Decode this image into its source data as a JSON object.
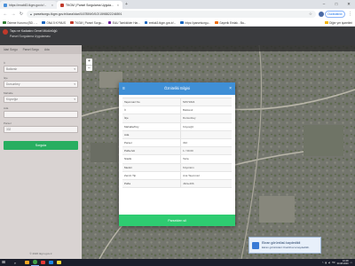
{
  "browser": {
    "tabs": [
      {
        "title": "https://enabil3.tkgm.gov.tr/...",
        "color": "#4a90d9"
      },
      {
        "title": "TKGM | Parsel Sorgulama Uygula...",
        "color": "#c0392b"
      }
    ],
    "new_tab": "+",
    "window": {
      "minimize": "–",
      "maximize": "□",
      "close": "✕"
    },
    "url": "parselsorgu.tkgm.gov.tr/#ara/idari/167859/0/0/2/1598822246591",
    "profile_label": "Duraklatıldı",
    "bookmarks": [
      {
        "label": "Ödeme Kurumu (BD - ...",
        "color": "#2e7d32"
      },
      {
        "label": "GNA 5 KYMUS",
        "color": "#1565c0"
      },
      {
        "label": "TKGM | Parsel Sorgu...",
        "color": "#c0392b"
      },
      {
        "label": "EAU Tamlıkikler Har...",
        "color": "#6a1b9a"
      },
      {
        "label": "erelak3.tkgm.gov.tr/...",
        "color": "#1565c0"
      },
      {
        "label": "https://parselsorgu...",
        "color": "#1565c0"
      },
      {
        "label": "Gayerik Emlak - Ba...",
        "color": "#ef6c00"
      }
    ],
    "other_bookmarks": "Diğer yer işaretleri"
  },
  "app": {
    "header_line1": "Tapu ve Kadastro Genel Müdürlüğü",
    "header_line2": "Parsel Sorgulama Uygulaması",
    "sidebar": {
      "tabs": [
        "İdari Sorgu",
        "Parsel Sorgu",
        "Ada"
      ],
      "fields": [
        {
          "label": "İl",
          "value": "Balıkesir"
        },
        {
          "label": "İlçe",
          "value": "Dursunbey"
        },
        {
          "label": "Mahalle",
          "value": "Köyceğiz"
        },
        {
          "label": "Ada",
          "value": ""
        },
        {
          "label": "Parsel",
          "value": "332"
        }
      ],
      "query_button": "Sorgula",
      "footer": "© 2020 tkgm.gov.tr"
    },
    "zoom": {
      "in": "+",
      "out": "−"
    }
  },
  "modal": {
    "title": "Özniteliki Bilgisi",
    "rows": [
      {
        "key": "Taşınmaz No",
        "value": "52571824"
      },
      {
        "key": "İl",
        "value": "Balıkesir"
      },
      {
        "key": "İlçe",
        "value": "Dursunbey"
      },
      {
        "key": "Mahalle/Köy",
        "value": "Köyceğiz"
      },
      {
        "key": "Ada",
        "value": ""
      },
      {
        "key": "Parsel",
        "value": "332"
      },
      {
        "key": "Pafta Adı",
        "value": "1 / 30.00"
      },
      {
        "key": "Nitelik",
        "value": "Tarla"
      },
      {
        "key": "Mevkii",
        "value": "Köyönüm"
      },
      {
        "key": "Zemin Tip",
        "value": "Ana Taşınmaz"
      },
      {
        "key": "Pafta",
        "value": "J22a-20b"
      }
    ],
    "footer_button": "Parselden sil"
  },
  "toast": {
    "title": "Ekran görüntüsü kaydedildi",
    "subtitle": "Ekran görüntüleri OneDrive'a kaydedildi."
  },
  "taskbar": {
    "start_icon": "⊞",
    "search_icon": "⌕",
    "apps": [
      "#f9a825",
      "#43a047",
      "#e53935",
      "#1e88e5",
      "#fdd835"
    ],
    "language": "TR",
    "time": "10:48",
    "date": "30.08.2020"
  }
}
